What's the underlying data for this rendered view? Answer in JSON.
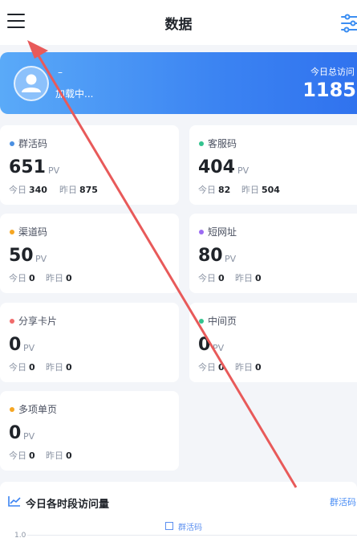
{
  "header": {
    "title": "数据",
    "menu_icon": "menu-icon",
    "filter_icon": "filter-icon"
  },
  "user": {
    "name": "–",
    "status": "加载中...",
    "visit_label": "今日总访问",
    "visit_value": "1185"
  },
  "cards": [
    {
      "name": "群活码",
      "total": "651",
      "unit": "PV",
      "today_label": "今日",
      "today": "340",
      "yesterday_label": "昨日",
      "yesterday": "875",
      "color": "#4a90e2"
    },
    {
      "name": "客服码",
      "total": "404",
      "unit": "PV",
      "today_label": "今日",
      "today": "82",
      "yesterday_label": "昨日",
      "yesterday": "504",
      "color": "#34c38f"
    },
    {
      "name": "渠道码",
      "total": "50",
      "unit": "PV",
      "today_label": "今日",
      "today": "0",
      "yesterday_label": "昨日",
      "yesterday": "0",
      "color": "#f5a623"
    },
    {
      "name": "短网址",
      "total": "80",
      "unit": "PV",
      "today_label": "今日",
      "today": "0",
      "yesterday_label": "昨日",
      "yesterday": "0",
      "color": "#9b6bf2"
    },
    {
      "name": "分享卡片",
      "total": "0",
      "unit": "PV",
      "today_label": "今日",
      "today": "0",
      "yesterday_label": "昨日",
      "yesterday": "0",
      "color": "#f06b6b"
    },
    {
      "name": "中间页",
      "total": "0",
      "unit": "PV",
      "today_label": "今日",
      "today": "0",
      "yesterday_label": "昨日",
      "yesterday": "0",
      "color": "#34c38f"
    },
    {
      "name": "多项单页",
      "total": "0",
      "unit": "PV",
      "today_label": "今日",
      "today": "0",
      "yesterday_label": "昨日",
      "yesterday": "0",
      "color": "#f5a623"
    }
  ],
  "chart": {
    "title": "今日各时段访问量",
    "filter_label": "群活码",
    "legend": "群活码",
    "y_tick": "1.0"
  },
  "colors": {
    "accent": "#3b83f2",
    "arrow": "#e85a5a"
  }
}
